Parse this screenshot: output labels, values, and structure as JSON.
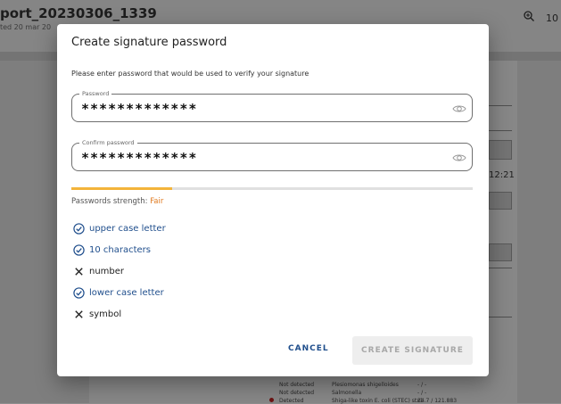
{
  "background": {
    "report_title": "port_20230306_1339",
    "report_subtitle": "ted 20 mar 20",
    "zoom_value": "10",
    "time_text": "12:21",
    "rows": [
      {
        "status": "Not detected",
        "name": "Plesiomonas shigelloides",
        "value": "- / -"
      },
      {
        "status": "Not detected",
        "name": "Salmonella",
        "value": "- / -"
      },
      {
        "status": "Detected",
        "name": "Shiga-like toxin E. coli (STEC) stx1",
        "value": "34.7 / 121.883"
      }
    ]
  },
  "dialog": {
    "title": "Create signature password",
    "description": "Please enter password that would be used to verify your signature",
    "password": {
      "label": "Password",
      "value": "*************"
    },
    "confirm_password": {
      "label": "Confirm password",
      "value": "*************"
    },
    "strength": {
      "label": "Passwords strength:",
      "level": "Fair",
      "fraction": 0.25
    },
    "requirements": [
      {
        "label": "upper case letter",
        "met": true
      },
      {
        "label": "10 characters",
        "met": true
      },
      {
        "label": "number",
        "met": false
      },
      {
        "label": "lower case letter",
        "met": true
      },
      {
        "label": "symbol",
        "met": false
      }
    ],
    "cancel_label": "CANCEL",
    "create_label": "CREATE SIGNATURE"
  },
  "colors": {
    "accent": "#1f4e8c",
    "strength_fair": "#e07a1f",
    "strength_bar": "#f3b43a"
  }
}
